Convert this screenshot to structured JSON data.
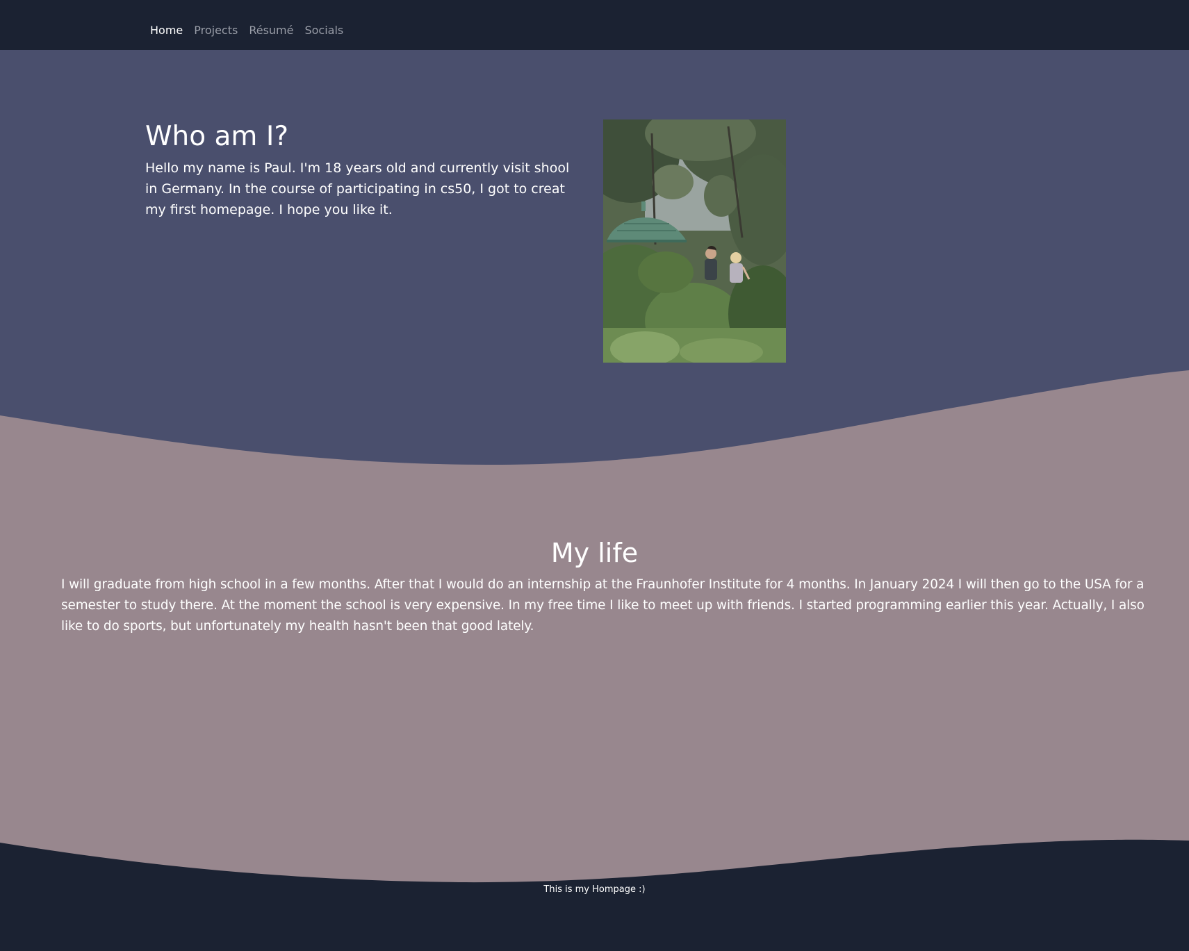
{
  "colors": {
    "navbar_bg": "#1b2232",
    "hero_bg": "#4a4f6d",
    "life_bg": "#98878e",
    "footer_bg": "#1b2232",
    "text": "#ffffff",
    "nav_inactive": "#9a9ea8"
  },
  "nav": {
    "items": [
      {
        "label": "Home",
        "active": true
      },
      {
        "label": "Projects",
        "active": false
      },
      {
        "label": "Résumé",
        "active": false
      },
      {
        "label": "Socials",
        "active": false
      }
    ]
  },
  "hero": {
    "title": "Who am I?",
    "text": "Hello my name is Paul. I'm 18 years old and currently visit shool in Germany. In the course of participating in cs50, I got to creat my first homepage. I hope you like it.",
    "photo_icon": "photo-two-people-in-garden"
  },
  "life": {
    "title": "My life",
    "text": "I will graduate from high school in a few months. After that I would do an internship at the Fraunhofer Institute for 4 months. In January 2024 I will then go to the USA for a semester to study there. At the moment the school is very expensive. In my free time I like to meet up with friends. I started programming earlier this year. Actually, I also like to do sports, but unfortunately my health hasn't been that good lately."
  },
  "footer": {
    "text": "This is my Hompage :)"
  }
}
